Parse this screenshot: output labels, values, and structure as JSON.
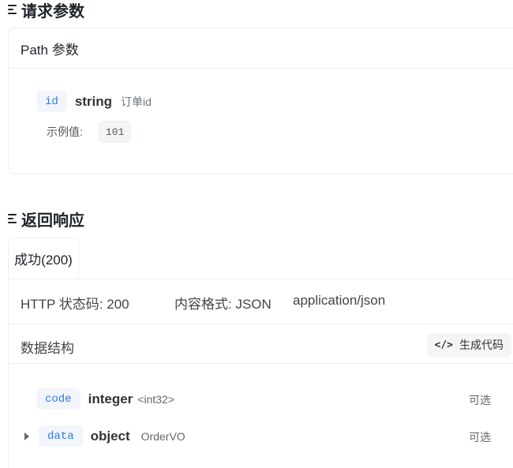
{
  "request": {
    "title": "请求参数",
    "path_header": "Path 参数",
    "param": {
      "tag": "id",
      "type": "string",
      "desc": "订单id",
      "example_label": "示例值:",
      "example_value": "101"
    }
  },
  "response": {
    "title": "返回响应",
    "tab_label": "成功(200)",
    "http_status": "HTTP 状态码: 200",
    "content_format": "内容格式: JSON",
    "mime": "application/json",
    "schema_title": "数据结构",
    "gen_code_label": "生成代码",
    "fields": [
      {
        "tag": "code",
        "type": "integer",
        "sub": "<int32>",
        "optional": "可选"
      },
      {
        "tag": "data",
        "type": "object",
        "sub": "OrderVO",
        "optional": "可选"
      }
    ]
  }
}
